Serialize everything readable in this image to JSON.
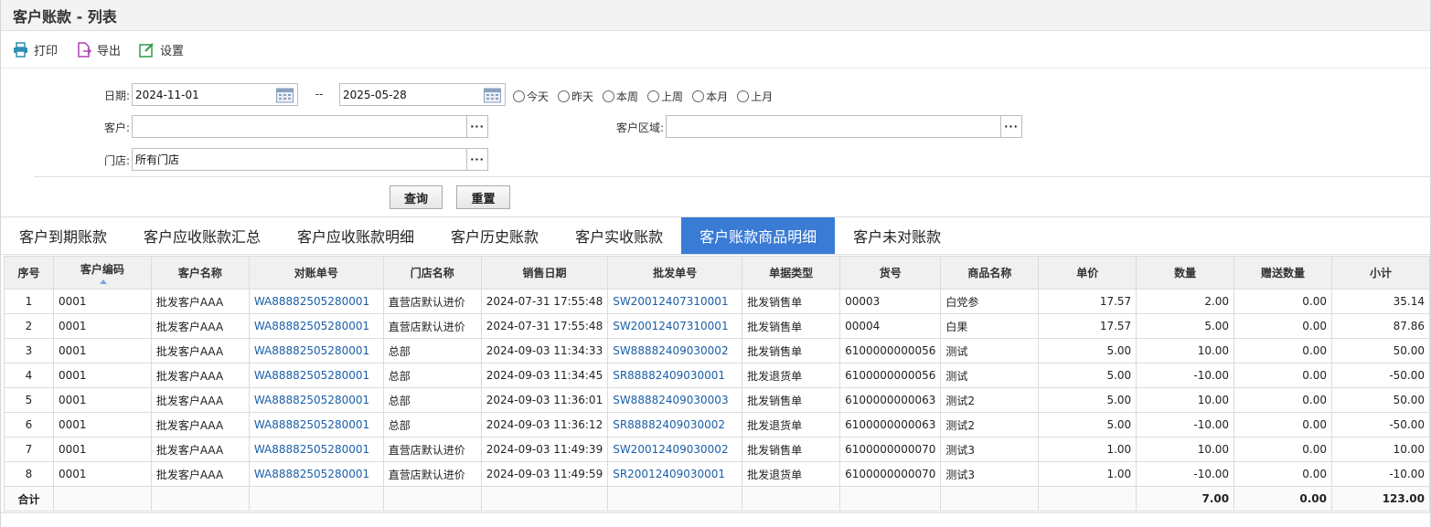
{
  "title": "客户账款 - 列表",
  "toolbar": {
    "print": "打印",
    "export": "导出",
    "settings": "设置"
  },
  "filters": {
    "date_label": "日期:",
    "date_from": "2024-11-01",
    "date_sep": "--",
    "date_to": "2025-05-28",
    "quick_dates": [
      "今天",
      "昨天",
      "本周",
      "上周",
      "本月",
      "上月"
    ],
    "customer_label": "客户:",
    "customer_value": "",
    "region_label": "客户区域:",
    "region_value": "",
    "store_label": "门店:",
    "store_value": "所有门店",
    "query": "查询",
    "reset": "重置"
  },
  "tabs": [
    "客户到期账款",
    "客户应收账款汇总",
    "客户应收账款明细",
    "客户历史账款",
    "客户实收账款",
    "客户账款商品明细",
    "客户未对账款"
  ],
  "active_tab": 5,
  "table": {
    "headers": [
      "序号",
      "客户编码",
      "客户名称",
      "对账单号",
      "门店名称",
      "销售日期",
      "批发单号",
      "单据类型",
      "货号",
      "商品名称",
      "单价",
      "数量",
      "赠送数量",
      "小计"
    ],
    "rows": [
      [
        "1",
        "0001",
        "批发客户AAA",
        "WA88882505280001",
        "直营店默认进价",
        "2024-07-31 17:55:48",
        "SW20012407310001",
        "批发销售单",
        "00003",
        "白党参",
        "17.57",
        "2.00",
        "0.00",
        "35.14"
      ],
      [
        "2",
        "0001",
        "批发客户AAA",
        "WA88882505280001",
        "直营店默认进价",
        "2024-07-31 17:55:48",
        "SW20012407310001",
        "批发销售单",
        "00004",
        "白果",
        "17.57",
        "5.00",
        "0.00",
        "87.86"
      ],
      [
        "3",
        "0001",
        "批发客户AAA",
        "WA88882505280001",
        "总部",
        "2024-09-03 11:34:33",
        "SW88882409030002",
        "批发销售单",
        "6100000000056",
        "测试",
        "5.00",
        "10.00",
        "0.00",
        "50.00"
      ],
      [
        "4",
        "0001",
        "批发客户AAA",
        "WA88882505280001",
        "总部",
        "2024-09-03 11:34:45",
        "SR88882409030001",
        "批发退货单",
        "6100000000056",
        "测试",
        "5.00",
        "-10.00",
        "0.00",
        "-50.00"
      ],
      [
        "5",
        "0001",
        "批发客户AAA",
        "WA88882505280001",
        "总部",
        "2024-09-03 11:36:01",
        "SW88882409030003",
        "批发销售单",
        "6100000000063",
        "测试2",
        "5.00",
        "10.00",
        "0.00",
        "50.00"
      ],
      [
        "6",
        "0001",
        "批发客户AAA",
        "WA88882505280001",
        "总部",
        "2024-09-03 11:36:12",
        "SR88882409030002",
        "批发退货单",
        "6100000000063",
        "测试2",
        "5.00",
        "-10.00",
        "0.00",
        "-50.00"
      ],
      [
        "7",
        "0001",
        "批发客户AAA",
        "WA88882505280001",
        "直营店默认进价",
        "2024-09-03 11:49:39",
        "SW20012409030002",
        "批发销售单",
        "6100000000070",
        "测试3",
        "1.00",
        "10.00",
        "0.00",
        "10.00"
      ],
      [
        "8",
        "0001",
        "批发客户AAA",
        "WA88882505280001",
        "直营店默认进价",
        "2024-09-03 11:49:59",
        "SR20012409030001",
        "批发退货单",
        "6100000000070",
        "测试3",
        "1.00",
        "-10.00",
        "0.00",
        "-10.00"
      ]
    ],
    "total_label": "合计",
    "totals": {
      "qty": "7.00",
      "gift": "0.00",
      "subtotal": "123.00"
    }
  },
  "colors": {
    "accent": "#3a7bd5",
    "link": "#1a5ea8"
  }
}
